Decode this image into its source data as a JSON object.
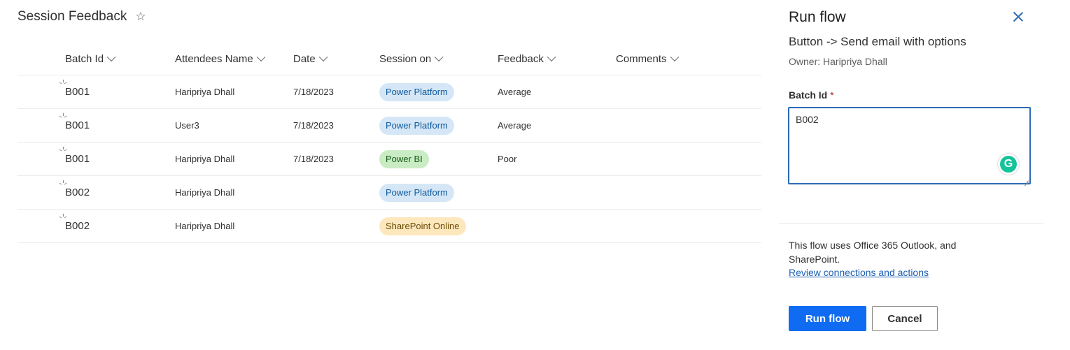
{
  "page": {
    "title": "Session Feedback",
    "favorite_icon": "star-outline-icon"
  },
  "table": {
    "columns": [
      "Batch Id",
      "Attendees Name",
      "Date",
      "Session on",
      "Feedback",
      "Comments"
    ],
    "rows": [
      {
        "batch_id": "B001",
        "attendee": "Haripriya Dhall",
        "date": "7/18/2023",
        "session": "Power Platform",
        "session_color": "blue",
        "feedback": "Average",
        "comments": ""
      },
      {
        "batch_id": "B001",
        "attendee": "User3",
        "date": "7/18/2023",
        "session": "Power Platform",
        "session_color": "blue",
        "feedback": "Average",
        "comments": ""
      },
      {
        "batch_id": "B001",
        "attendee": "Haripriya Dhall",
        "date": "7/18/2023",
        "session": "Power BI",
        "session_color": "green",
        "feedback": "Poor",
        "comments": ""
      },
      {
        "batch_id": "B002",
        "attendee": "Haripriya Dhall",
        "date": "",
        "session": "Power Platform",
        "session_color": "blue",
        "feedback": "",
        "comments": ""
      },
      {
        "batch_id": "B002",
        "attendee": "Haripriya Dhall",
        "date": "",
        "session": "SharePoint Online",
        "session_color": "yellow",
        "feedback": "",
        "comments": ""
      }
    ]
  },
  "panel": {
    "title": "Run flow",
    "flow_name": "Button -> Send email with options",
    "owner": "Owner: Haripriya Dhall",
    "field": {
      "label": "Batch Id",
      "required_mark": "*",
      "value": "B002"
    },
    "grammarly_letter": "G",
    "info_text": "This flow uses Office 365 Outlook, and SharePoint.",
    "review_link": "Review connections and actions",
    "run_button": "Run flow",
    "cancel_button": "Cancel"
  },
  "colors": {
    "accent": "#0f6cf2",
    "link": "#1a5fb4",
    "tag_blue": "#d5e7f6",
    "tag_green": "#caecc4",
    "tag_yellow": "#fde7bd"
  }
}
